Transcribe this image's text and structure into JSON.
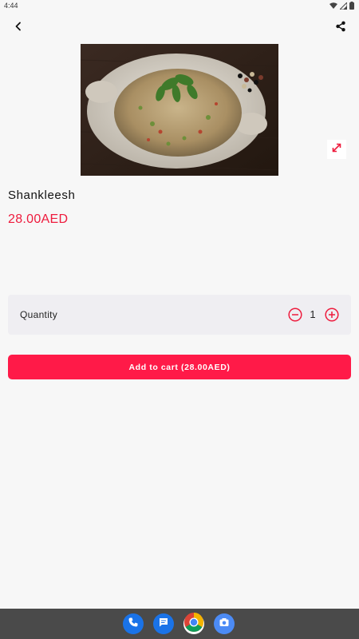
{
  "status_bar": {
    "time": "4:44"
  },
  "product": {
    "name": "Shankleesh",
    "price": "28.00AED"
  },
  "quantity": {
    "label": "Quantity",
    "value": "1"
  },
  "cart_button": {
    "label": "Add to cart (28.00AED)"
  },
  "colors": {
    "accent": "#ff1a48",
    "price": "#ee1b3d",
    "card": "#efeef2",
    "nav_bar": "#4a4a4a"
  },
  "icons": {
    "back": "back-arrow-icon",
    "share": "share-icon",
    "expand": "expand-icon",
    "minus": "minus-circle-icon",
    "plus": "plus-circle-icon",
    "dock": [
      "phone-icon",
      "messages-icon",
      "chrome-icon",
      "camera-icon"
    ]
  }
}
